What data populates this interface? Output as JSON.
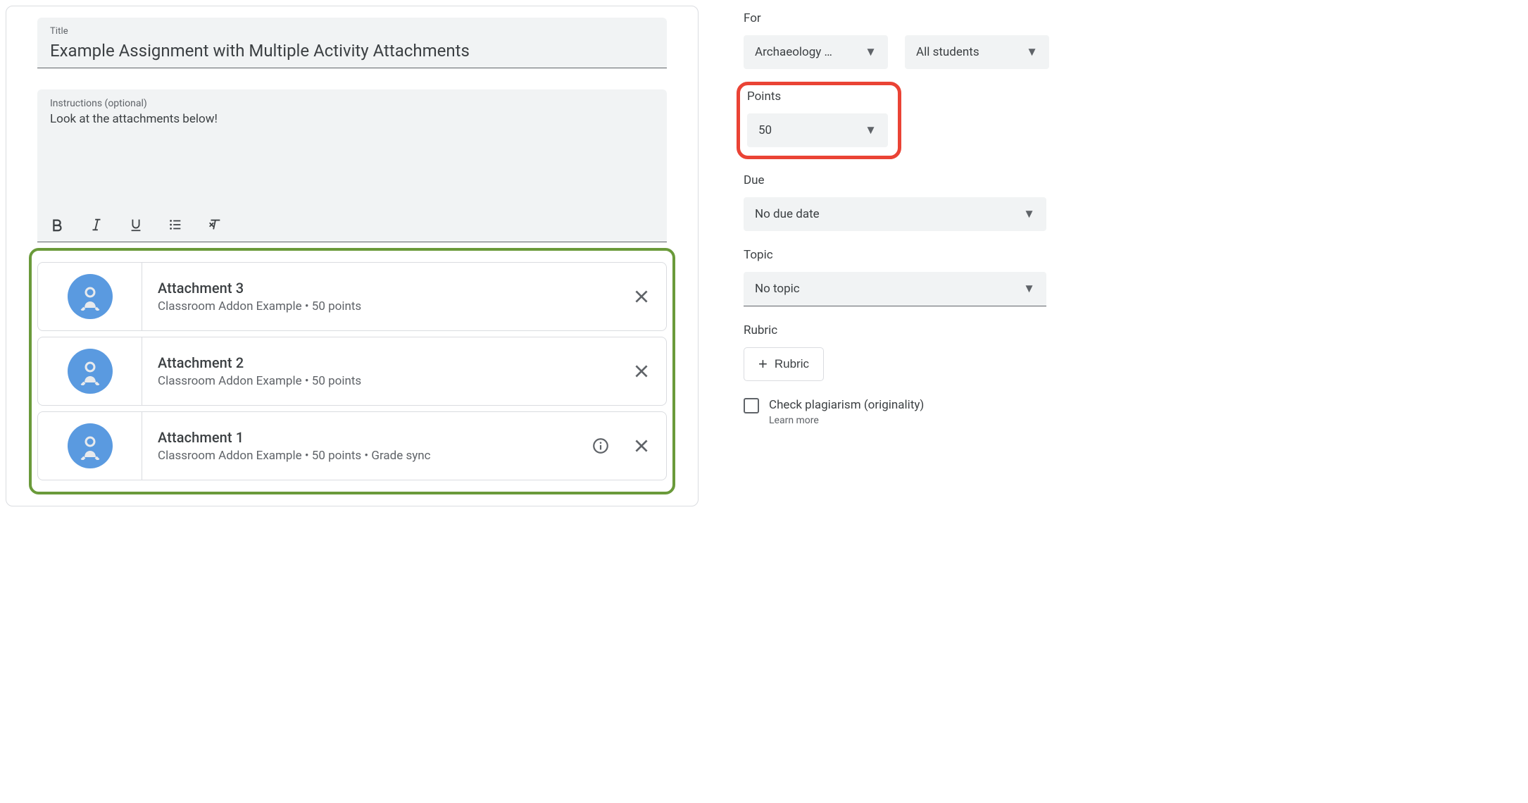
{
  "title": {
    "label": "Title",
    "value": "Example Assignment with Multiple Activity Attachments"
  },
  "instructions": {
    "label": "Instructions (optional)",
    "value": "Look at the attachments below!"
  },
  "attachments": [
    {
      "title": "Attachment 3",
      "subtitle": "Classroom Addon Example • 50 points",
      "has_info": false
    },
    {
      "title": "Attachment 2",
      "subtitle": "Classroom Addon Example • 50 points",
      "has_info": false
    },
    {
      "title": "Attachment 1",
      "subtitle": "Classroom Addon Example • 50 points • Grade sync",
      "has_info": true
    }
  ],
  "sidebar": {
    "for_label": "For",
    "class_select": "Archaeology …",
    "students_select": "All students",
    "points_label": "Points",
    "points_value": "50",
    "due_label": "Due",
    "due_value": "No due date",
    "topic_label": "Topic",
    "topic_value": "No topic",
    "rubric_label": "Rubric",
    "rubric_button": "Rubric",
    "plagiarism_label": "Check plagiarism (originality)",
    "learn_more": "Learn more"
  }
}
